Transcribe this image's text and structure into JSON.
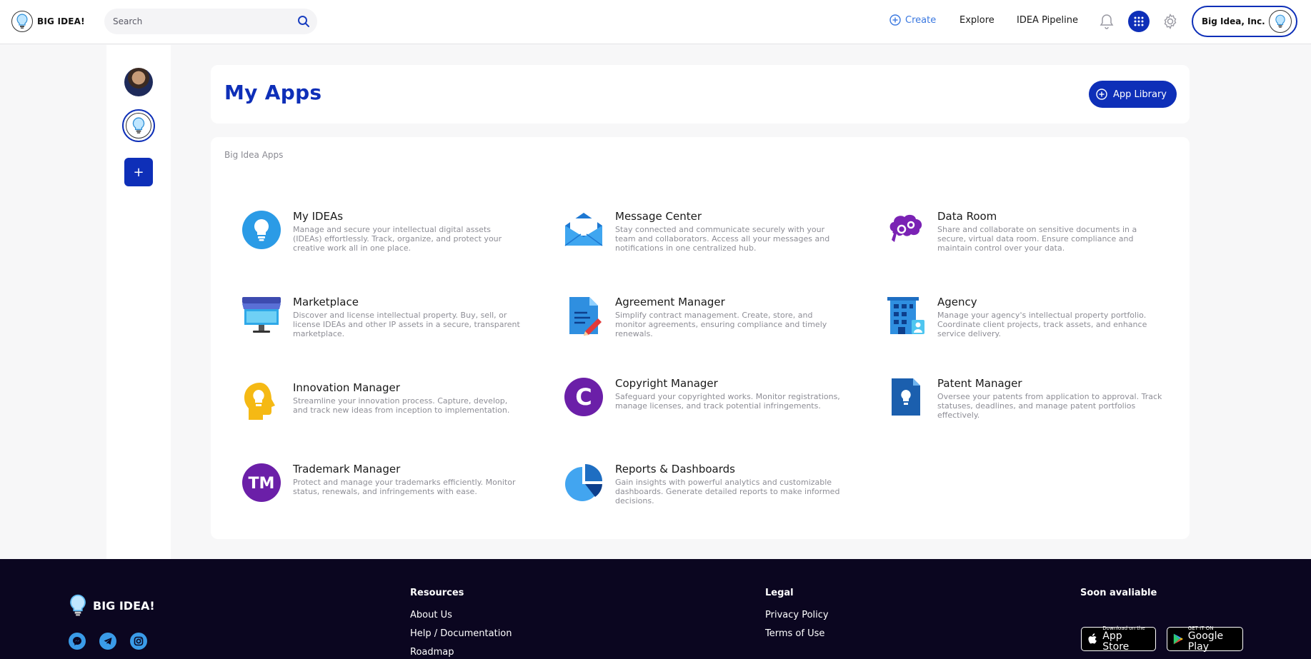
{
  "header": {
    "logo_text": "BIG IDEA!",
    "search_placeholder": "Search",
    "nav": {
      "create": "Create",
      "explore": "Explore",
      "pipeline": "IDEA Pipeline"
    },
    "account_name": "Big Idea, Inc."
  },
  "page": {
    "title": "My Apps",
    "app_library_label": "App Library",
    "section_label": "Big Idea Apps"
  },
  "apps": [
    {
      "name": "My IDEAs",
      "description": "Manage and secure your intellectual digital assets (IDEAs) effortlessly. Track, organize, and protect your creative work all in one place.",
      "icon": "bulb-icon"
    },
    {
      "name": "Message Center",
      "description": "Stay connected and communicate securely with your team and collaborators. Access all your messages and notifications in one centralized hub.",
      "icon": "envelope-icon"
    },
    {
      "name": "Data Room",
      "description": "Share and collaborate on sensitive documents in a secure, virtual data room. Ensure compliance and maintain control over your data.",
      "icon": "brain-gears-icon"
    },
    {
      "name": "Marketplace",
      "description": "Discover and license intellectual property. Buy, sell, or license IDEAs and other IP assets in a secure, transparent marketplace.",
      "icon": "storefront-icon"
    },
    {
      "name": "Agreement Manager",
      "description": "Simplify contract management. Create, store, and monitor agreements, ensuring compliance and timely renewals.",
      "icon": "document-pen-icon"
    },
    {
      "name": "Agency",
      "description": "Manage your agency's intellectual property portfolio. Coordinate client projects, track assets, and enhance service delivery.",
      "icon": "building-icon"
    },
    {
      "name": "Innovation Manager",
      "description": "Streamline your innovation process. Capture, develop, and track new ideas from inception to implementation.",
      "icon": "head-bulb-icon"
    },
    {
      "name": "Copyright Manager",
      "description": "Safeguard your copyrighted works. Monitor registrations, manage licenses, and track potential infringements.",
      "icon": "copyright-icon",
      "glyph": "C"
    },
    {
      "name": "Patent Manager",
      "description": "Oversee your patents from application to approval. Track statuses, deadlines, and manage patent portfolios effectively.",
      "icon": "patent-doc-icon"
    },
    {
      "name": "Trademark Manager",
      "description": "Protect and manage your trademarks efficiently. Monitor status, renewals, and infringements with ease.",
      "icon": "trademark-icon",
      "glyph": "TM"
    },
    {
      "name": "Reports & Dashboards",
      "description": "Gain insights with powerful analytics and customizable dashboards. Generate detailed reports to make informed decisions.",
      "icon": "pie-chart-icon"
    }
  ],
  "footer": {
    "logo_text": "BIG IDEA!",
    "resources_heading": "Resources",
    "resources_links": [
      "About Us",
      "Help / Documentation",
      "Roadmap"
    ],
    "legal_heading": "Legal",
    "legal_links": [
      "Privacy Policy",
      "Terms of Use"
    ],
    "soon_heading": "Soon avaliable",
    "app_store_small": "Download on the",
    "app_store_big": "App Store",
    "play_small": "GET IT ON",
    "play_big": "Google Play"
  },
  "colors": {
    "brand_blue": "#0e2fb8",
    "link_blue": "#3a78e0",
    "footer_bg": "#0b0620",
    "purple": "#6b1fa8"
  }
}
